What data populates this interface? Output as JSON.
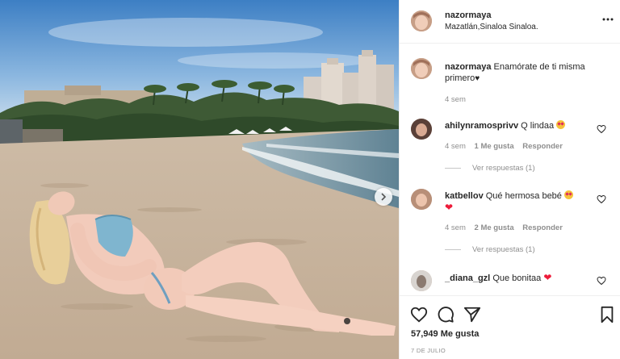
{
  "post": {
    "username": "nazormaya",
    "location": "Mazatlán,Sinaloa Sinaloa.",
    "caption": {
      "username": "nazormaya",
      "text": "Enamórate de ti misma primero",
      "emoji": "♥",
      "time": "4 sem"
    },
    "comments": [
      {
        "username": "ahilynramosprivv",
        "text": "Q lindaa",
        "emoji": "star-struck-emoji",
        "time": "4 sem",
        "likes": "1 Me gusta",
        "reply_label": "Responder",
        "view_replies": "Ver respuestas (1)"
      },
      {
        "username": "katbellov",
        "text": "Qué hermosa bebé",
        "emoji": "star-struck-emoji",
        "emoji2": "❤",
        "time": "4 sem",
        "likes": "2 Me gusta",
        "reply_label": "Responder",
        "view_replies": "Ver respuestas (1)"
      },
      {
        "username": "_diana_gzl",
        "text": "Que bonitaa",
        "emoji": "❤"
      }
    ],
    "likes_count": "57,949 Me gusta",
    "date": "7 DE JULIO"
  },
  "icons": {
    "more": "more-options-icon",
    "heart": "heart-icon",
    "comment": "comment-icon",
    "share": "share-icon",
    "save": "bookmark-icon",
    "next": "chevron-right-icon"
  },
  "colors": {
    "text": "#262626",
    "secondary": "#8e8e8e",
    "border": "#efefef",
    "heart_red": "#ed1c3a"
  }
}
